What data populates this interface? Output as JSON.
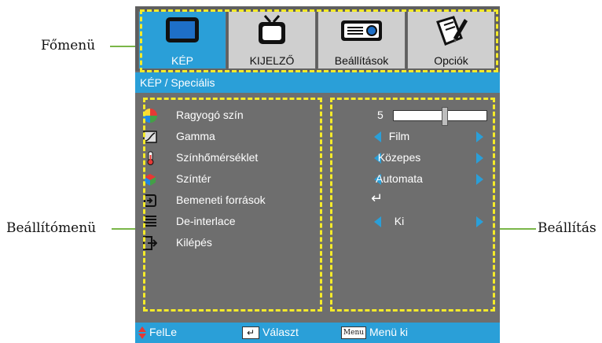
{
  "callouts": {
    "main_menu": "Főmenü",
    "settings_menu": "Beállítómenü",
    "setting": "Beállítás"
  },
  "tabs": [
    {
      "label": "KÉP",
      "icon": "monitor-icon",
      "active": true
    },
    {
      "label": "KIJELZŐ",
      "icon": "tv-icon",
      "active": false
    },
    {
      "label": "Beállítások",
      "icon": "projector-icon",
      "active": false
    },
    {
      "label": "Opciók",
      "icon": "tools-icon",
      "active": false
    }
  ],
  "breadcrumb": "KÉP / Speciális",
  "rows": [
    {
      "label": "Ragyogó szín",
      "icon": "color-wheel-icon",
      "value": "5",
      "slider_fraction": 0.55
    },
    {
      "label": "Gamma",
      "icon": "gamma-icon",
      "value": "Film"
    },
    {
      "label": "Színhőmérséklet",
      "icon": "thermometer-icon",
      "value": "Közepes"
    },
    {
      "label": "Színtér",
      "icon": "color-cube-icon",
      "value": "Automata"
    },
    {
      "label": "Bemeneti források",
      "icon": "input-source-icon",
      "value": "↵"
    },
    {
      "label": "De-interlace",
      "icon": "deinterlace-icon",
      "value": "Ki"
    },
    {
      "label": "Kilépés",
      "icon": "exit-icon",
      "value": ""
    }
  ],
  "bottom": {
    "updown": "FelLe",
    "select": "Választ",
    "menu_key": "Menu",
    "menu_exit": "Menü ki"
  },
  "colors": {
    "accent": "#2a9fd8",
    "highlight": "#f4ea2a",
    "callout_line": "#7ab648"
  }
}
